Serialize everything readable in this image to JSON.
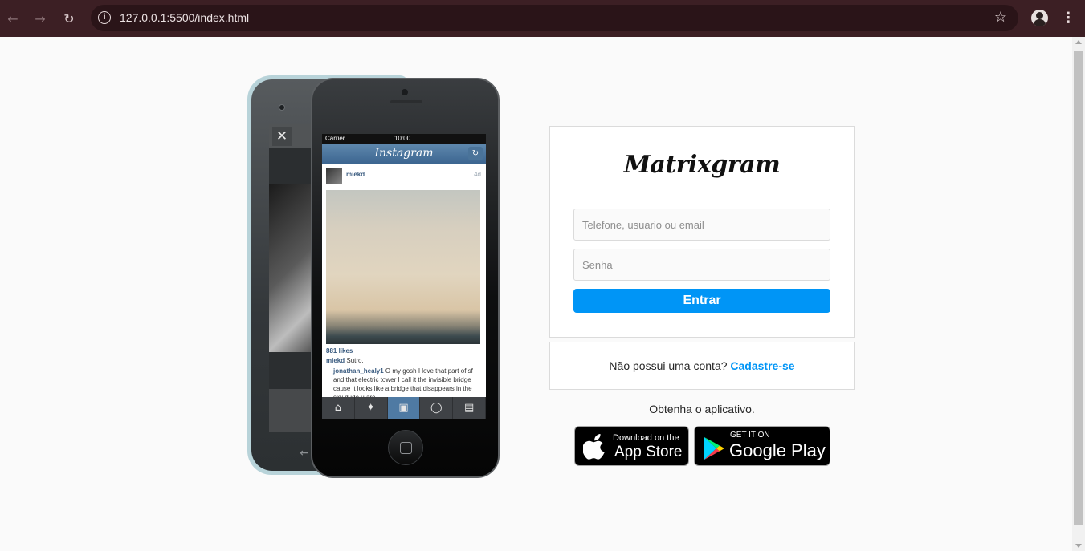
{
  "browser": {
    "url": "127.0.0.1:5500/index.html"
  },
  "phone_mockup": {
    "status_carrier": "Carrier",
    "status_time": "10:00",
    "app_title": "Instagram",
    "post_user": "miekd",
    "post_time": "4d",
    "likes": "881 likes",
    "comment_1_user": "miekd",
    "comment_1_text": "Sutro.",
    "comment_2_user": "jonathan_healy1",
    "comment_2_text": "O my gosh I love that part of sf and that electric tower I call it the invisible bridge cause it looks like a bridge that disappears in the sky dude u are"
  },
  "login": {
    "brand": "Matrixgram",
    "user_placeholder": "Telefone, usuario ou email",
    "password_placeholder": "Senha",
    "submit_label": "Entrar"
  },
  "signup": {
    "prompt": "Não possui uma conta?",
    "link": "Cadastre-se"
  },
  "get_app": {
    "label": "Obtenha o aplicativo.",
    "app_store_small": "Download on the",
    "app_store_big": "App Store",
    "google_play_small": "GET IT ON",
    "google_play_big": "Google Play"
  },
  "colors": {
    "chrome_bar": "#3c1f24",
    "primary_button": "#0095f6",
    "page_background": "#fafafa"
  }
}
